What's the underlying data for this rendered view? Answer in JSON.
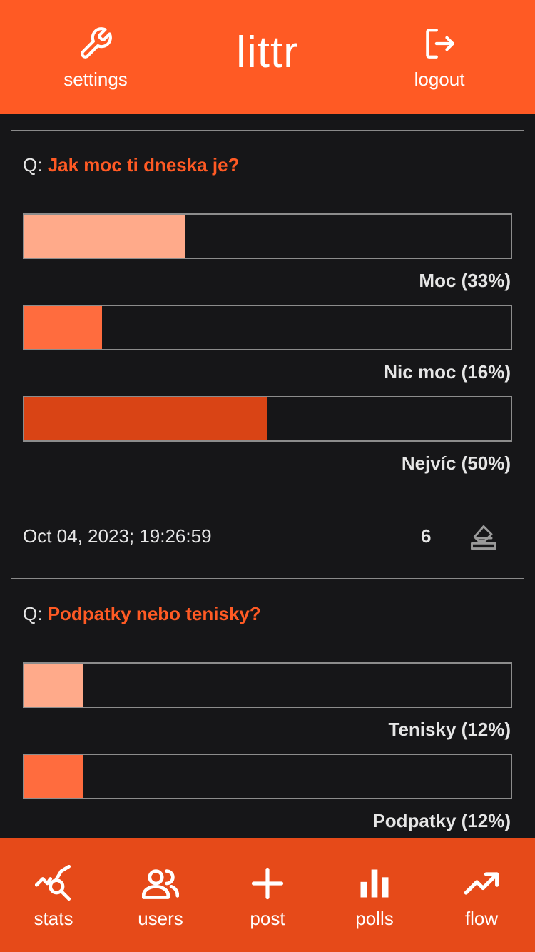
{
  "header": {
    "settings_label": "settings",
    "brand": "littr",
    "logout_label": "logout"
  },
  "polls": [
    {
      "q_prefix": "Q:",
      "question": "Jak moc ti dneska je?",
      "options": [
        {
          "label": "Moc (33%)",
          "percent": 33
        },
        {
          "label": "Nic moc (16%)",
          "percent": 16
        },
        {
          "label": "Nejvíc (50%)",
          "percent": 50
        }
      ],
      "timestamp": "Oct 04, 2023; 19:26:59",
      "votes": "6"
    },
    {
      "q_prefix": "Q:",
      "question": "Podpatky nebo tenisky?",
      "options": [
        {
          "label": "Tenisky (12%)",
          "percent": 12
        },
        {
          "label": "Podpatky (12%)",
          "percent": 12
        }
      ]
    }
  ],
  "nav": {
    "items": [
      {
        "label": "stats",
        "icon": "stats-icon"
      },
      {
        "label": "users",
        "icon": "users-icon"
      },
      {
        "label": "post",
        "icon": "plus-icon"
      },
      {
        "label": "polls",
        "icon": "polls-icon"
      },
      {
        "label": "flow",
        "icon": "trending-icon"
      }
    ]
  },
  "colors": {
    "header_bg": "#ff5a24",
    "nav_bg": "#e64a19",
    "page_bg": "#161618",
    "question_color": "#ff5a24",
    "bar_colors": [
      "#ffaa8a",
      "#ff6c3e",
      "#d94415"
    ]
  }
}
